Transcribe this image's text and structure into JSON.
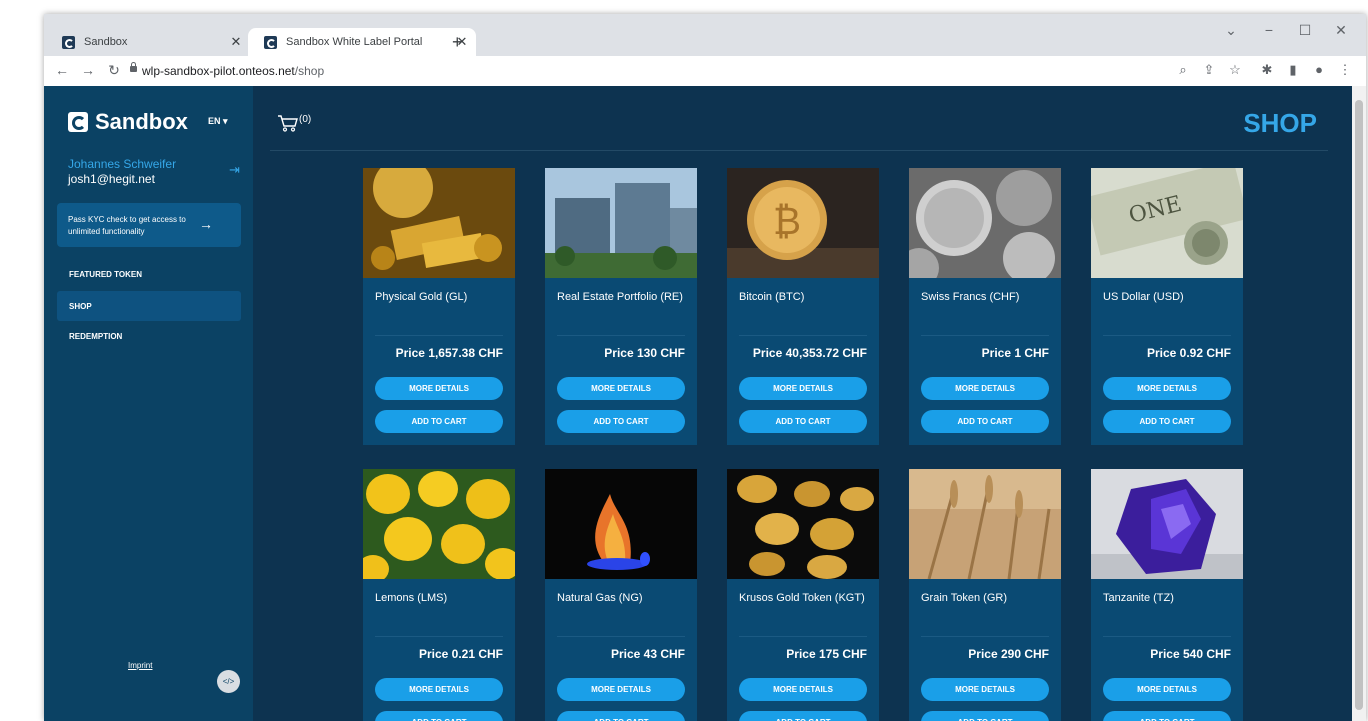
{
  "browser": {
    "tabs": [
      {
        "title": "Sandbox",
        "active": false
      },
      {
        "title": "Sandbox White Label Portal",
        "active": true
      }
    ],
    "url_host": "wlp-sandbox-pilot.onteos.net",
    "url_path": "/shop"
  },
  "sidebar": {
    "logo_text": "Sandbox",
    "language": "EN",
    "user_name": "Johannes Schweifer",
    "user_email": "josh1@hegit.net",
    "kyc_text": "Pass KYC check to get access to unlimited functionality",
    "nav": [
      {
        "label": "FEATURED TOKEN",
        "active": false
      },
      {
        "label": "SHOP",
        "active": true
      },
      {
        "label": "REDEMPTION",
        "active": false
      }
    ],
    "imprint": "Imprint",
    "code_button": "</>"
  },
  "header": {
    "cart_count": "(0)",
    "title": "SHOP"
  },
  "products": [
    {
      "name": "Physical Gold (GL)",
      "price": "Price 1,657.38 CHF",
      "image": "gold-bars-image"
    },
    {
      "name": "Real Estate Portfolio (RE)",
      "price": "Price 130 CHF",
      "image": "office-building-image"
    },
    {
      "name": "Bitcoin (BTC)",
      "price": "Price 40,353.72 CHF",
      "image": "bitcoin-coin-image"
    },
    {
      "name": "Swiss Francs (CHF)",
      "price": "Price 1 CHF",
      "image": "swiss-coins-image"
    },
    {
      "name": "US Dollar (USD)",
      "price": "Price 0.92 CHF",
      "image": "dollar-bill-image"
    },
    {
      "name": "Lemons (LMS)",
      "price": "Price 0.21 CHF",
      "image": "lemons-image"
    },
    {
      "name": "Natural Gas (NG)",
      "price": "Price 43 CHF",
      "image": "gas-flame-image"
    },
    {
      "name": "Krusos Gold Token (KGT)",
      "price": "Price 175 CHF",
      "image": "gold-coins-image"
    },
    {
      "name": "Grain Token (GR)",
      "price": "Price 290 CHF",
      "image": "wheat-field-image"
    },
    {
      "name": "Tanzanite (TZ)",
      "price": "Price 540 CHF",
      "image": "tanzanite-gem-image"
    }
  ],
  "buttons": {
    "more_details": "MORE DETAILS",
    "add_to_cart": "ADD TO CART"
  }
}
